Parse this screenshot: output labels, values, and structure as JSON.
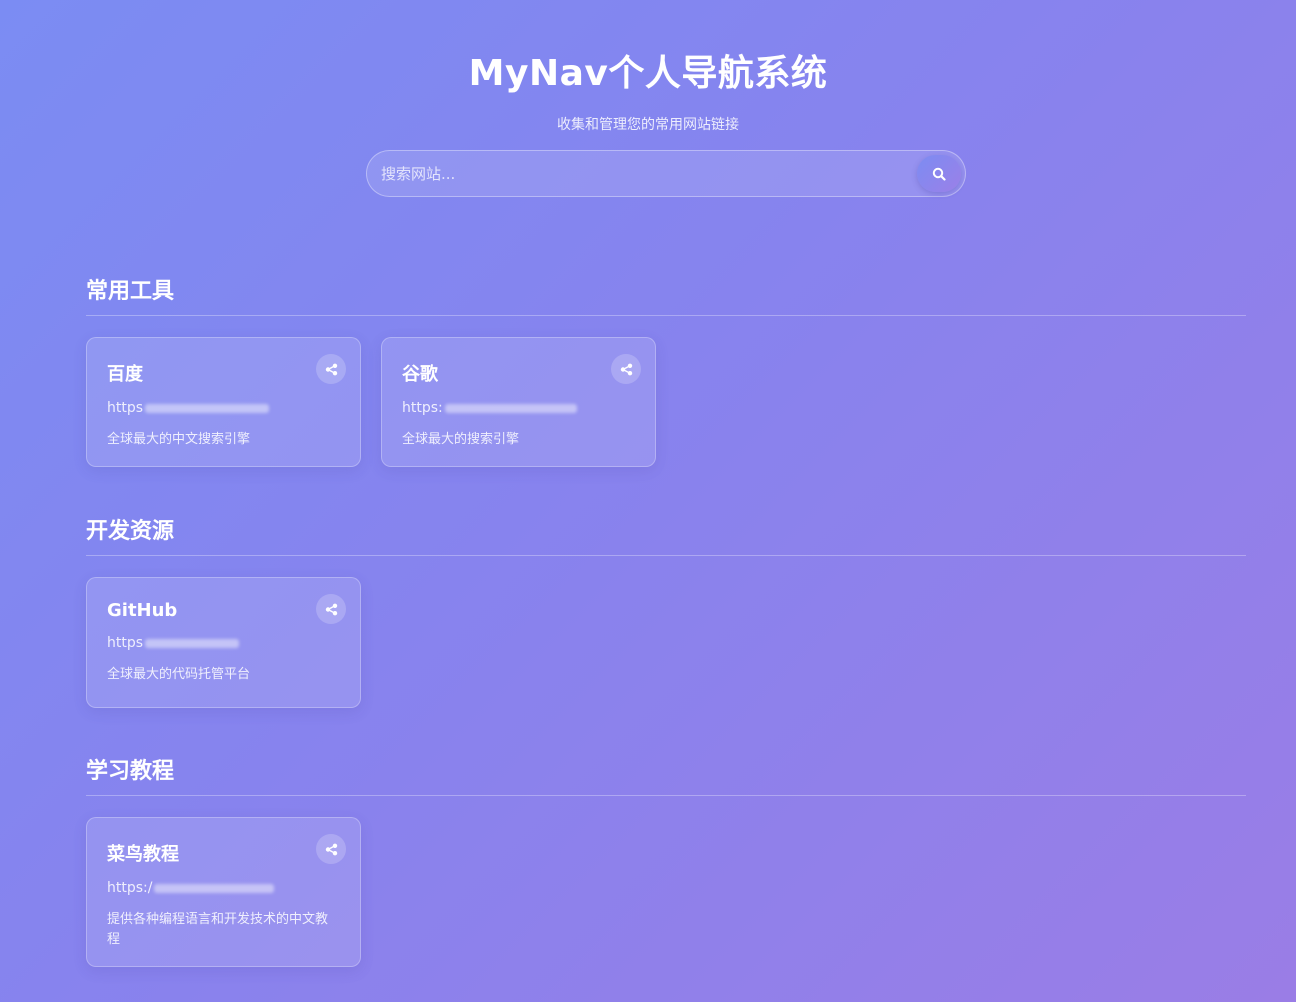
{
  "header": {
    "title": "MyNav个人导航系统",
    "subtitle": "收集和管理您的常用网站链接"
  },
  "search": {
    "placeholder": "搜索网站...",
    "button_icon": "search-icon"
  },
  "sections": [
    {
      "title": "常用工具",
      "cards": [
        {
          "name": "百度",
          "url_prefix": "https",
          "desc": "全球最大的中文搜索引擎",
          "share_icon": "share-icon"
        },
        {
          "name": "谷歌",
          "url_prefix": "https:",
          "desc": "全球最大的搜索引擎",
          "share_icon": "share-icon"
        }
      ]
    },
    {
      "title": "开发资源",
      "cards": [
        {
          "name": "GitHub",
          "url_prefix": "https",
          "desc": "全球最大的代码托管平台",
          "share_icon": "share-icon"
        }
      ]
    },
    {
      "title": "学习教程",
      "cards": [
        {
          "name": "菜鸟教程",
          "url_prefix": "https:/",
          "desc": "提供各种编程语言和开发技术的中文教程",
          "share_icon": "share-icon"
        }
      ]
    }
  ],
  "colors": {
    "gradient_start": "#7b8cf3",
    "gradient_end": "#9a7de6",
    "text": "#ffffff"
  }
}
